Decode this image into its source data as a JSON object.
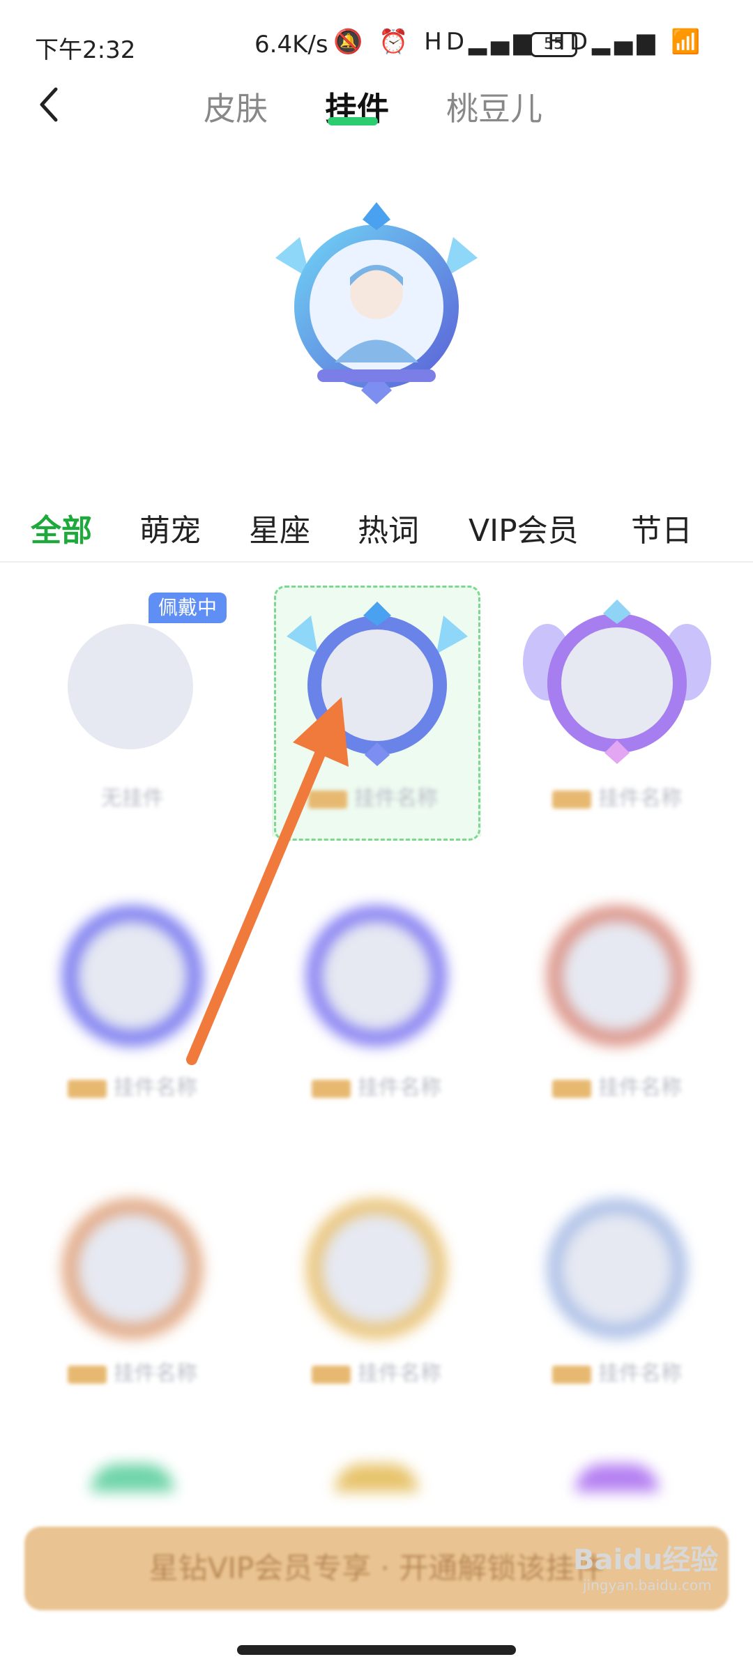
{
  "status_bar": {
    "time": "下午2:32",
    "network_speed": "6.4K/s",
    "icons": "🔕 ⏰ HD▂▄▆ HD▂▄▆ 📶",
    "battery": "55"
  },
  "header": {
    "back_icon": "chevron-left",
    "tabs": [
      "皮肤",
      "挂件",
      "桃豆儿"
    ],
    "active_tab_index": 1
  },
  "categories": {
    "items": [
      "全部",
      "萌宠",
      "星座",
      "热词",
      "VIP会员",
      "节日"
    ],
    "active_index": 0
  },
  "grid": {
    "wearing_badge": "佩戴中",
    "items": [
      {
        "label": "无挂件",
        "style": "none",
        "selected": false
      },
      {
        "label": "",
        "style": "blue-diamond",
        "selected": true
      },
      {
        "label": "",
        "style": "purple-wings",
        "selected": false
      },
      {
        "label": "",
        "style": "violet-ring",
        "selected": false
      },
      {
        "label": "",
        "style": "indigo-ring",
        "selected": false
      },
      {
        "label": "",
        "style": "rose-ring",
        "selected": false
      },
      {
        "label": "",
        "style": "bronze-ring",
        "selected": false
      },
      {
        "label": "",
        "style": "gold-ring",
        "selected": false
      },
      {
        "label": "",
        "style": "silver-ring",
        "selected": false
      }
    ]
  },
  "banner": {
    "text": "星钻VIP会员专享 · 开通解锁该挂件"
  },
  "watermark": {
    "text": "Baidu经验",
    "subtext": "jingyan.baidu.com"
  },
  "colors": {
    "accent_green": "#1fa83b",
    "badge_blue": "#5f8ff5",
    "arrow_orange": "#f07a3c"
  }
}
